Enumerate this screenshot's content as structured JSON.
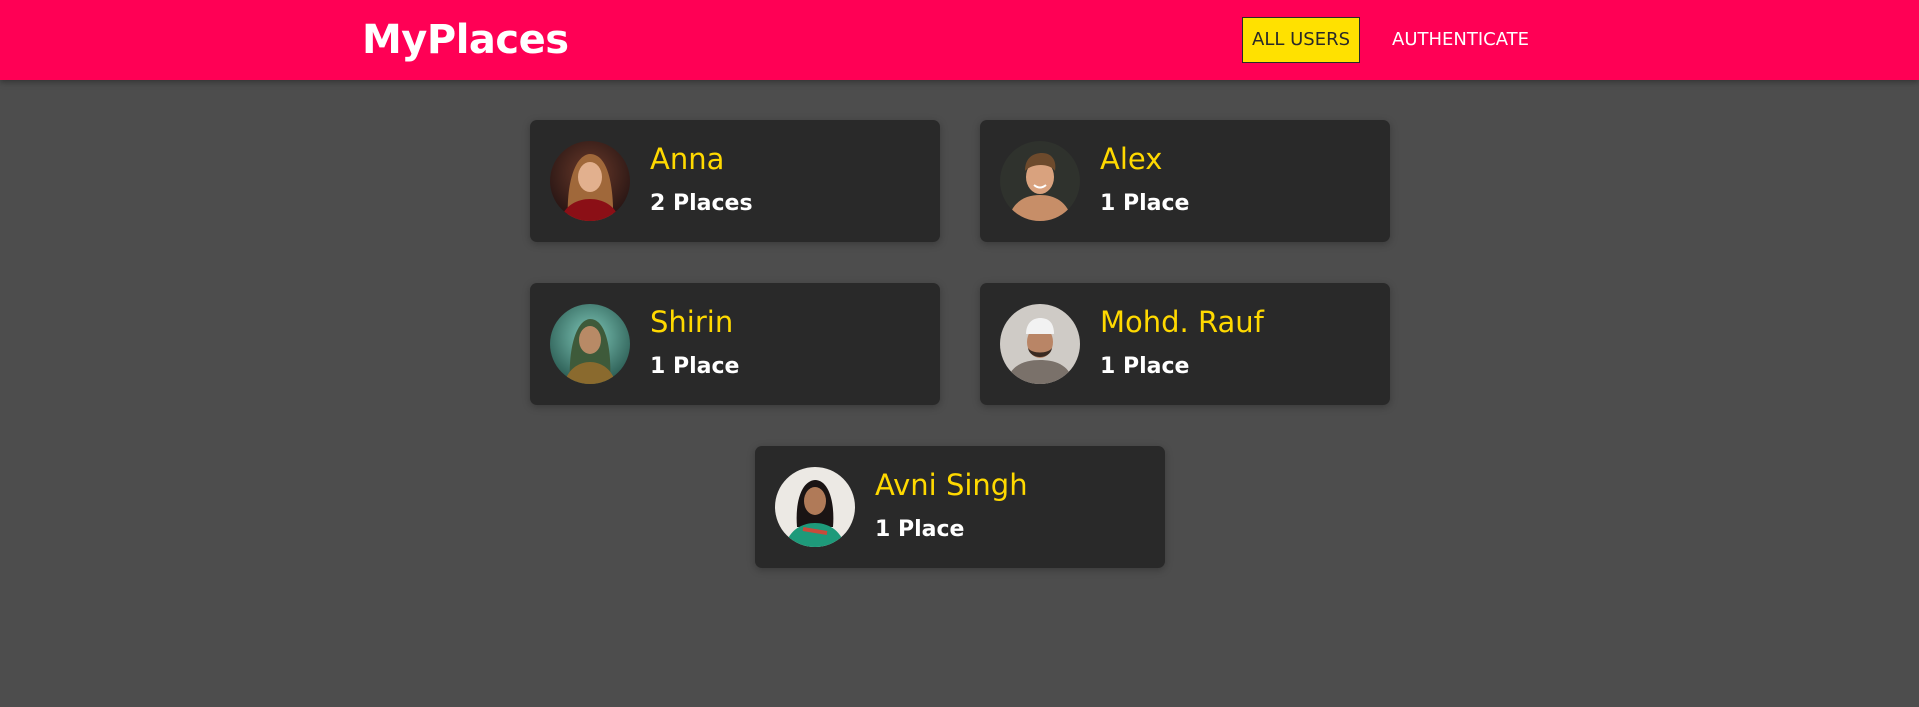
{
  "header": {
    "logo": "MyPlaces",
    "nav": {
      "all_users": "ALL USERS",
      "authenticate": "AUTHENTICATE"
    },
    "brand_color": "#ff0055",
    "active_nav_color": "#ffe100"
  },
  "users": [
    {
      "name": "Anna",
      "places": "2 Places",
      "avatar": "avatar-anna"
    },
    {
      "name": "Alex",
      "places": "1 Place",
      "avatar": "avatar-alex"
    },
    {
      "name": "Shirin",
      "places": "1 Place",
      "avatar": "avatar-shirin"
    },
    {
      "name": "Mohd. Rauf",
      "places": "1 Place",
      "avatar": "avatar-mohd-rauf"
    },
    {
      "name": "Avni Singh",
      "places": "1 Place",
      "avatar": "avatar-avni-singh"
    }
  ]
}
